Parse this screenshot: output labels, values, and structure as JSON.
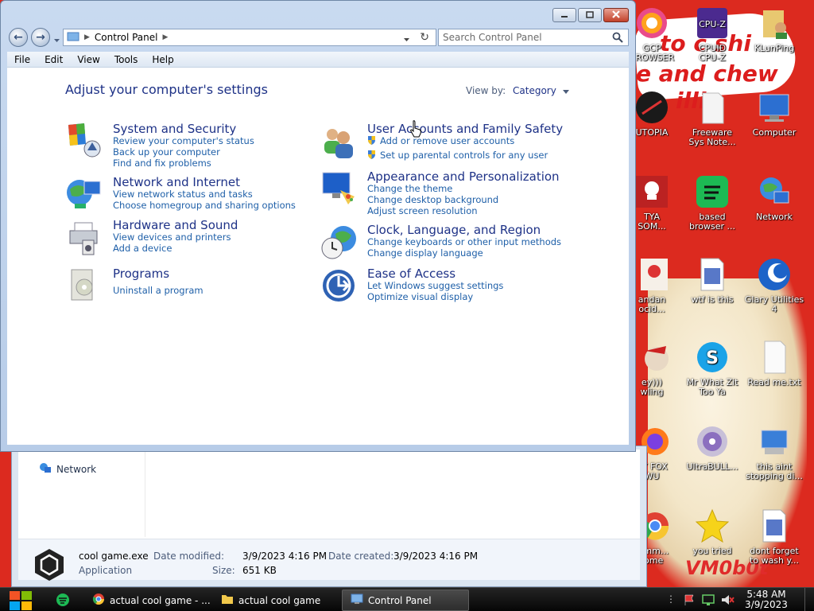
{
  "desktop": {
    "wallpaper_text": [
      "to c shi",
      "e and chew",
      "illin"
    ],
    "watermark": "VM0b0t",
    "icons": [
      {
        "label": "GCP\nBROWSER",
        "icon": "colorful-browser-icon"
      },
      {
        "label": "CPUID\nCPU-Z",
        "icon": "cpuz-icon"
      },
      {
        "label": "KLunPing",
        "icon": "folder-user-icon"
      },
      {
        "label": "UTOPIA",
        "icon": "utopia-icon"
      },
      {
        "label": "Freeware\nSys Note...",
        "icon": "document-icon"
      },
      {
        "label": "Computer",
        "icon": "computer-icon"
      },
      {
        "label": "TYA\nSOM...",
        "icon": "skull-icon"
      },
      {
        "label": "based\nbrowser ...",
        "icon": "spotify-icon"
      },
      {
        "label": "Network",
        "icon": "network-globe-icon"
      },
      {
        "label": "andan\nocid...",
        "icon": "meme-icon"
      },
      {
        "label": "wtf is this",
        "icon": "grid-document-icon"
      },
      {
        "label": "Glary Utilities\n4",
        "icon": "glary-icon"
      },
      {
        "label": "ey)))\nwling",
        "icon": "santa-icon"
      },
      {
        "label": "Mr What Zit\nToo Ya",
        "icon": "skype-icon"
      },
      {
        "label": "Read me.txt",
        "icon": "text-file-icon"
      },
      {
        "label": "XY FOX\nWU",
        "icon": "firefox-icon"
      },
      {
        "label": "UltraBULL...",
        "icon": "disc-icon"
      },
      {
        "label": "this aint\nstopping di...",
        "icon": "installer-icon"
      },
      {
        "label": "mmm...\nrome",
        "icon": "chrome-icon"
      },
      {
        "label": "you tried",
        "icon": "star-icon"
      },
      {
        "label": "dont forget\nto wash y...",
        "icon": "grid-document-icon"
      }
    ]
  },
  "bg_explorer": {
    "nav_item": "Network",
    "file": {
      "name": "cool game.exe",
      "type": "Application",
      "date_modified_label": "Date modified:",
      "date_modified": "3/9/2023 4:16 PM",
      "date_created_label": "Date created:",
      "date_created": "3/9/2023 4:16 PM",
      "size_label": "Size:",
      "size": "651 KB"
    }
  },
  "control_panel": {
    "breadcrumb": "Control Panel",
    "search_placeholder": "Search Control Panel",
    "menu": [
      "File",
      "Edit",
      "View",
      "Tools",
      "Help"
    ],
    "page_title": "Adjust your computer's settings",
    "view_by_label": "View by:",
    "view_by_value": "Category",
    "categories": [
      {
        "title": "System and Security",
        "icon": "shield-icon",
        "links": [
          "Review your computer's status",
          "Back up your computer",
          "Find and fix problems"
        ]
      },
      {
        "title": "Network and Internet",
        "icon": "network-globe-icon",
        "links": [
          "View network status and tasks",
          "Choose homegroup and sharing options"
        ]
      },
      {
        "title": "Hardware and Sound",
        "icon": "printer-icon",
        "links": [
          "View devices and printers",
          "Add a device"
        ]
      },
      {
        "title": "Programs",
        "icon": "programs-icon",
        "links": [
          "Uninstall a program"
        ]
      },
      {
        "title": "User Accounts and Family Safety",
        "icon": "users-icon",
        "links": [
          "Add or remove user accounts",
          "Set up parental controls for any user"
        ]
      },
      {
        "title": "Appearance and Personalization",
        "icon": "monitor-palette-icon",
        "links": [
          "Change the theme",
          "Change desktop background",
          "Adjust screen resolution"
        ]
      },
      {
        "title": "Clock, Language, and Region",
        "icon": "clock-globe-icon",
        "links": [
          "Change keyboards or other input methods",
          "Change display language"
        ]
      },
      {
        "title": "Ease of Access",
        "icon": "ease-access-icon",
        "links": [
          "Let Windows suggest settings",
          "Optimize visual display"
        ]
      }
    ]
  },
  "taskbar": {
    "apps": [
      {
        "label": "actual cool game - ...",
        "icon": "chrome-icon"
      },
      {
        "label": "actual cool game",
        "icon": "folder-icon"
      },
      {
        "label": "Control Panel",
        "icon": "control-panel-icon"
      }
    ],
    "time": "5:48 AM",
    "date": "3/9/2023"
  }
}
